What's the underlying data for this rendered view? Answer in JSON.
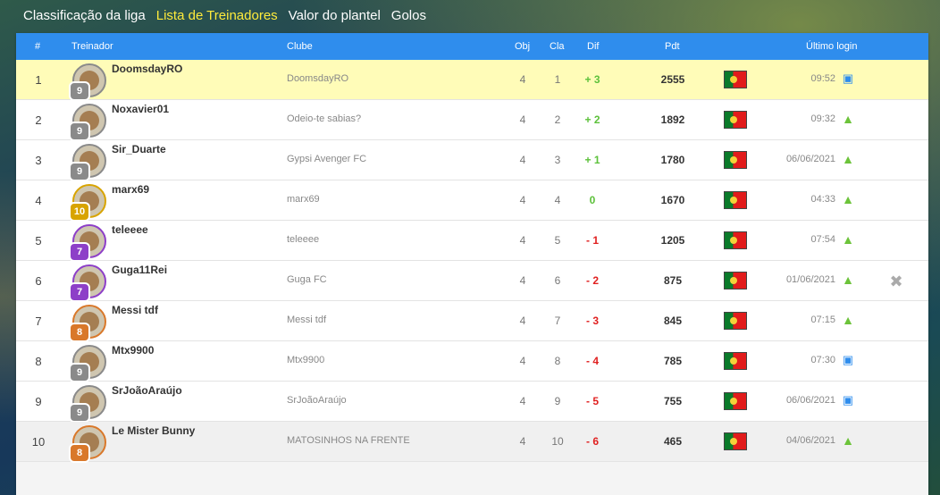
{
  "tabs": [
    {
      "label": "Classificação da liga",
      "active": false
    },
    {
      "label": "Lista de Treinadores",
      "active": true
    },
    {
      "label": "Valor do plantel",
      "active": false
    },
    {
      "label": "Golos",
      "active": false
    }
  ],
  "table": {
    "headers": {
      "rank": "#",
      "coach": "Treinador",
      "club": "Clube",
      "obj": "Obj",
      "cla": "Cla",
      "dif": "Dif",
      "pdt": "Pdt",
      "login": "Último login"
    },
    "rows": [
      {
        "rank": "1",
        "name": "DoomsdayRO",
        "level": "9",
        "club": "DoomsdayRO",
        "obj": "4",
        "cla": "1",
        "dif": "+ 3",
        "pdt": "2555",
        "login": "09:52",
        "device": "desktop-icon"
      },
      {
        "rank": "2",
        "name": "Noxavier01",
        "level": "9",
        "club": "Odeio-te sabias?",
        "obj": "4",
        "cla": "2",
        "dif": "+ 2",
        "pdt": "1892",
        "login": "09:32",
        "device": "android-icon"
      },
      {
        "rank": "3",
        "name": "Sir_Duarte",
        "level": "9",
        "club": "Gypsi Avenger FC",
        "obj": "4",
        "cla": "3",
        "dif": "+ 1",
        "pdt": "1780",
        "login": "06/06/2021",
        "device": "android-icon"
      },
      {
        "rank": "4",
        "name": "marx69",
        "level": "10",
        "club": "marx69",
        "obj": "4",
        "cla": "4",
        "dif": "0",
        "pdt": "1670",
        "login": "04:33",
        "device": "android-icon"
      },
      {
        "rank": "5",
        "name": "teleeee",
        "level": "7",
        "club": "teleeee",
        "obj": "4",
        "cla": "5",
        "dif": "- 1",
        "pdt": "1205",
        "login": "07:54",
        "device": "android-icon"
      },
      {
        "rank": "6",
        "name": "Guga11Rei",
        "level": "7",
        "club": "Guga FC",
        "obj": "4",
        "cla": "6",
        "dif": "- 2",
        "pdt": "875",
        "login": "01/06/2021",
        "device": "android-icon"
      },
      {
        "rank": "7",
        "name": "Messi tdf",
        "level": "8",
        "club": "Messi tdf",
        "obj": "4",
        "cla": "7",
        "dif": "- 3",
        "pdt": "845",
        "login": "07:15",
        "device": "android-icon"
      },
      {
        "rank": "8",
        "name": "Mtx9900",
        "level": "9",
        "club": "Mtx9900",
        "obj": "4",
        "cla": "8",
        "dif": "- 4",
        "pdt": "785",
        "login": "07:30",
        "device": "desktop-icon"
      },
      {
        "rank": "9",
        "name": "SrJoãoAraújo",
        "level": "9",
        "club": "SrJoãoAraújo",
        "obj": "4",
        "cla": "9",
        "dif": "- 5",
        "pdt": "755",
        "login": "06/06/2021",
        "device": "desktop-icon"
      },
      {
        "rank": "10",
        "name": "Le Mister Bunny",
        "level": "8",
        "club": "MATOSINHOS NA FRENTE",
        "obj": "4",
        "cla": "10",
        "dif": "- 6",
        "pdt": "465",
        "login": "04/06/2021",
        "device": "android-icon"
      }
    ]
  },
  "colors": {
    "header_bg": "#2f8ded",
    "highlight_row": "#fffcb8",
    "positive": "#5cc13a",
    "negative": "#e02020",
    "active_tab": "#ffeb3b",
    "level_gray": "#8a8a8a",
    "level_gold": "#d8a400",
    "level_purple": "#8d3fc8",
    "level_orange": "#d9782a"
  },
  "flag_icon": "portugal-flag-icon",
  "remove_friend_icon": "remove-user-icon"
}
